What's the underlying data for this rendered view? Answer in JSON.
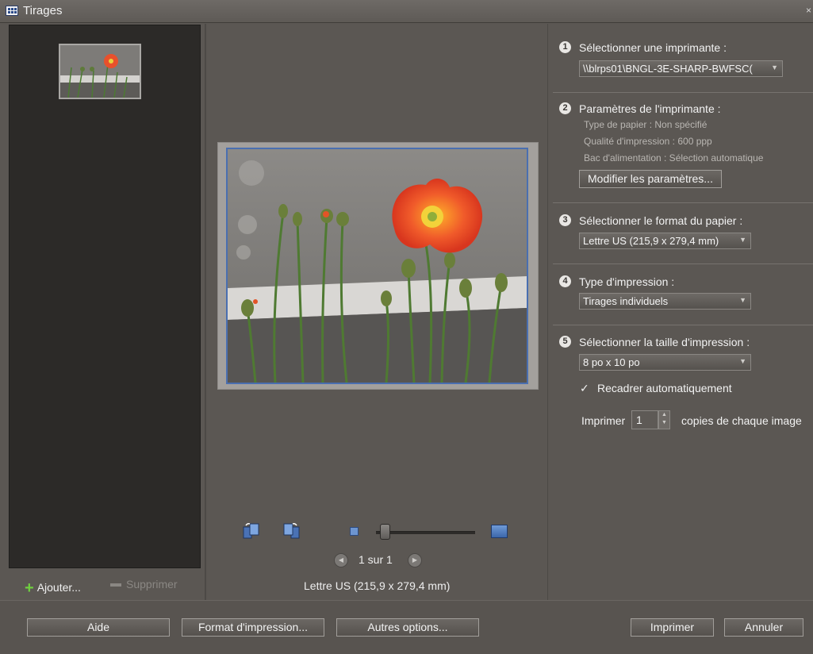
{
  "window": {
    "title": "Tirages",
    "close_glyph": "×"
  },
  "left_panel": {
    "thumbnail_alt": "Coquelicot orange",
    "add_label": "Ajouter...",
    "remove_label": "Supprimer"
  },
  "preview": {
    "page_indicator": "1 sur 1",
    "paper_caption": "Lettre US (215,9 x 279,4 mm)",
    "zoom_level": 0.05
  },
  "steps": {
    "printer": {
      "number": "1",
      "label": "Sélectionner une imprimante :",
      "value": "\\\\blrps01\\BNGL-3E-SHARP-BWFSC("
    },
    "printer_settings": {
      "number": "2",
      "label": "Paramètres de l'imprimante :",
      "paper_type": "Type de papier : Non spécifié",
      "quality": "Qualité d'impression : 600 ppp",
      "tray": "Bac d'alimentation : Sélection automatique",
      "modify_button": "Modifier les paramètres..."
    },
    "paper_format": {
      "number": "3",
      "label": "Sélectionner le format du papier :",
      "value": "Lettre US (215,9 x 279,4 mm)"
    },
    "print_type": {
      "number": "4",
      "label": "Type d'impression :",
      "value": "Tirages individuels"
    },
    "print_size": {
      "number": "5",
      "label": "Sélectionner la taille d'impression :",
      "value": "8 po x 10 po",
      "crop_label": "Recadrer automatiquement",
      "crop_checked": true,
      "copies_prefix": "Imprimer",
      "copies_value": "1",
      "copies_suffix": "copies de chaque image"
    }
  },
  "buttons": {
    "help": "Aide",
    "page_setup": "Format d'impression...",
    "more_options": "Autres options...",
    "print": "Imprimer",
    "cancel": "Annuler"
  },
  "icons": {
    "app": "grid-icon",
    "rotate_left": "rotate-left-icon",
    "rotate_right": "rotate-right-icon",
    "prev": "chevron-left-icon",
    "next": "chevron-right-icon"
  },
  "colors": {
    "accent": "#4a6fb0",
    "add_green": "#6fcf3f",
    "panel_bg": "#5b5753"
  }
}
